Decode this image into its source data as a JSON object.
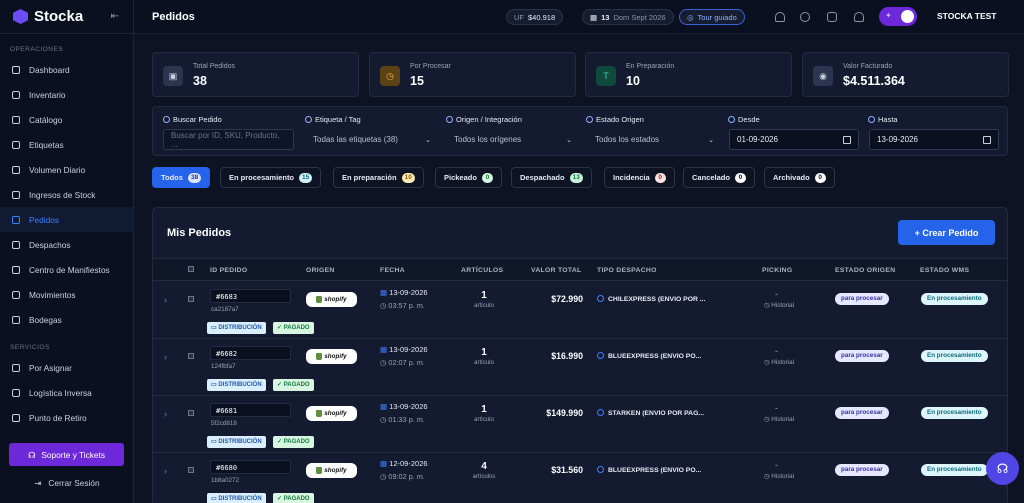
{
  "app": {
    "name": "Stocka"
  },
  "sidebar": {
    "section_ops": "OPERACIONES",
    "ops_items": [
      {
        "label": "Dashboard"
      },
      {
        "label": "Inventario"
      },
      {
        "label": "Catálogo"
      },
      {
        "label": "Etiquetas"
      },
      {
        "label": "Volumen Diario"
      },
      {
        "label": "Ingresos de Stock"
      },
      {
        "label": "Pedidos"
      },
      {
        "label": "Despachos"
      },
      {
        "label": "Centro de Manifiestos"
      },
      {
        "label": "Movimientos"
      },
      {
        "label": "Bodegas"
      }
    ],
    "section_services": "SERVICIOS",
    "service_items": [
      {
        "label": "Por Asignar"
      },
      {
        "label": "Logística Inversa"
      },
      {
        "label": "Punto de Retiro"
      }
    ],
    "support_label": "Soporte y Tickets",
    "logout_label": "Cerrar Sesión"
  },
  "header": {
    "title": "Pedidos",
    "uf_label": "UF",
    "uf_value": "$40.918",
    "date_day": "13",
    "date_rest": "Dom Sept 2026",
    "tour_label": "Tour guiado",
    "user_name": "STOCKA TEST"
  },
  "stats": [
    {
      "label": "Total Pedidos",
      "value": "38",
      "color": "#2b3550"
    },
    {
      "label": "Por Procesar",
      "value": "15",
      "color": "#5a4214"
    },
    {
      "label": "En Preparación",
      "value": "10",
      "color": "#0f4a3c"
    },
    {
      "label": "Valor Facturado",
      "value": "$4.511.364",
      "color": "#2b3550"
    }
  ],
  "filters": {
    "search_label": "Buscar Pedido",
    "search_placeholder": "Buscar por ID, SKU, Producto, ...",
    "tag_label": "Etiqueta / Tag",
    "tag_value": "Todas las etiquetas (38)",
    "origin_label": "Origen / Integración",
    "origin_value": "Todos los orígenes",
    "state_label": "Estado Origen",
    "state_value": "Todos los estados",
    "from_label": "Desde",
    "from_value": "01-09-2026",
    "to_label": "Hasta",
    "to_value": "13-09-2026"
  },
  "tabs": [
    {
      "label": "Todos",
      "count": "38",
      "badge_color": "#dbe7ff"
    },
    {
      "label": "En procesamiento",
      "count": "15",
      "badge_color": "#d3f0fb"
    },
    {
      "label": "En preparación",
      "count": "10",
      "badge_color": "#fdebb3"
    },
    {
      "label": "Pickeado",
      "count": "0",
      "badge_color": "#d8f5e2"
    },
    {
      "label": "Despachado",
      "count": "13",
      "badge_color": "#c9f2dd"
    },
    {
      "label": "Incidencia",
      "count": "0",
      "badge_color": "#fde2e2"
    },
    {
      "label": "Cancelado",
      "count": "0",
      "badge_color": "#ffffff"
    },
    {
      "label": "Archivado",
      "count": "0",
      "badge_color": "#ffffff"
    }
  ],
  "orders_panel": {
    "title": "Mis Pedidos",
    "create_label": "+ Crear Pedido",
    "columns": [
      "ID PEDIDO",
      "ORIGEN",
      "FECHA",
      "ARTÍCULOS",
      "VALOR TOTAL",
      "TIPO DESPACHO",
      "PICKING",
      "ESTADO ORIGEN",
      "ESTADO WMS"
    ],
    "rows": [
      {
        "id": "#6683",
        "hash": "ca2187a7",
        "origin": "shopify",
        "date": "13-09-2026",
        "time": "03:57 p. m.",
        "qty": "1",
        "qty_label": "artículo",
        "total": "$72.990",
        "shipping": "CHILEXPRESS (ENVIO POR ...",
        "picking": "-",
        "history": "Historial",
        "origin_state": "para procesar",
        "wms_state": "En procesamiento",
        "tag_dist": "DISTRIBUCIÓN",
        "tag_paid": "PAGADO"
      },
      {
        "id": "#6682",
        "hash": "124fbfa7",
        "origin": "shopify",
        "date": "13-09-2026",
        "time": "02:07 p. m.",
        "qty": "1",
        "qty_label": "artículo",
        "total": "$16.990",
        "shipping": "BLUEEXPRESS (ENVIO PO...",
        "picking": "-",
        "history": "Historial",
        "origin_state": "para procesar",
        "wms_state": "En procesamiento",
        "tag_dist": "DISTRIBUCIÓN",
        "tag_paid": "PAGADO"
      },
      {
        "id": "#6681",
        "hash": "5f2cd818",
        "origin": "shopify",
        "date": "13-09-2026",
        "time": "01:33 p. m.",
        "qty": "1",
        "qty_label": "artículo",
        "total": "$149.990",
        "shipping": "STARKEN (ENVIO POR PAG...",
        "picking": "-",
        "history": "Historial",
        "origin_state": "para procesar",
        "wms_state": "En procesamiento",
        "tag_dist": "DISTRIBUCIÓN",
        "tag_paid": "PAGADO"
      },
      {
        "id": "#6680",
        "hash": "1b8a0272",
        "origin": "shopify",
        "date": "12-09-2026",
        "time": "09:02 p. m.",
        "qty": "4",
        "qty_label": "artículos",
        "total": "$31.560",
        "shipping": "BLUEEXPRESS (ENVIO PO...",
        "picking": "-",
        "history": "Historial",
        "origin_state": "para procesar",
        "wms_state": "En procesamiento",
        "tag_dist": "DISTRIBUCIÓN",
        "tag_paid": "PAGADO"
      }
    ]
  }
}
